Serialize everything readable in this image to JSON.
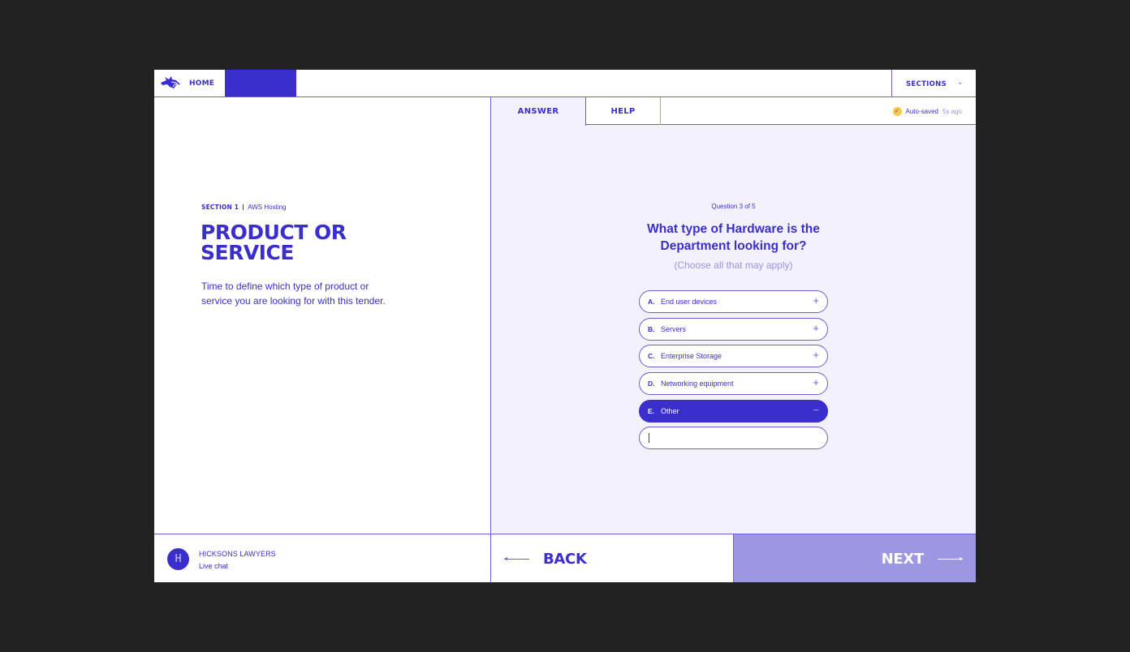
{
  "header": {
    "home_label": "HOME",
    "logo_icon": "wolf-head-logo",
    "sections_label": "SECTIONS",
    "sections_icon": "chevron-down-icon"
  },
  "colors": {
    "primary": "#3a2ecc",
    "border": "#6a5fd6",
    "panel_bg": "#f3f2fc",
    "next_bg": "#9c96e3",
    "autosave_check": "#f5c84a",
    "muted_text": "#9a93de"
  },
  "section": {
    "number_label": "SECTION 1",
    "name": "AWS Hosting",
    "title": "PRODUCT OR SERVICE",
    "description": "Time to define which type of product or service you are looking for with this tender."
  },
  "tabs": [
    {
      "label": "ANSWER",
      "active": true
    },
    {
      "label": "HELP",
      "active": false
    }
  ],
  "autosave": {
    "icon": "check-circle-icon",
    "label": "Auto-saved",
    "time": "5s ago"
  },
  "question": {
    "counter": "Question 3 of 5",
    "text": "What type of Hardware is the Department looking for?",
    "hint": "(Choose all that may apply)",
    "options": [
      {
        "letter": "A.",
        "label": "End user devices",
        "selected": false,
        "sign": "+"
      },
      {
        "letter": "B.",
        "label": "Servers",
        "selected": false,
        "sign": "+"
      },
      {
        "letter": "C.",
        "label": "Enterprise Storage",
        "selected": false,
        "sign": "+"
      },
      {
        "letter": "D.",
        "label": "Networking equipment",
        "selected": false,
        "sign": "+"
      },
      {
        "letter": "E.",
        "label": "Other",
        "selected": true,
        "sign": "−"
      }
    ],
    "other_input": {
      "value": "",
      "placeholder": ""
    }
  },
  "footer": {
    "chat": {
      "avatar_letter": "H",
      "org_name": "HICKSONS LAWYERS",
      "subtitle": "Live chat"
    },
    "back_label": "BACK",
    "next_label": "NEXT"
  }
}
